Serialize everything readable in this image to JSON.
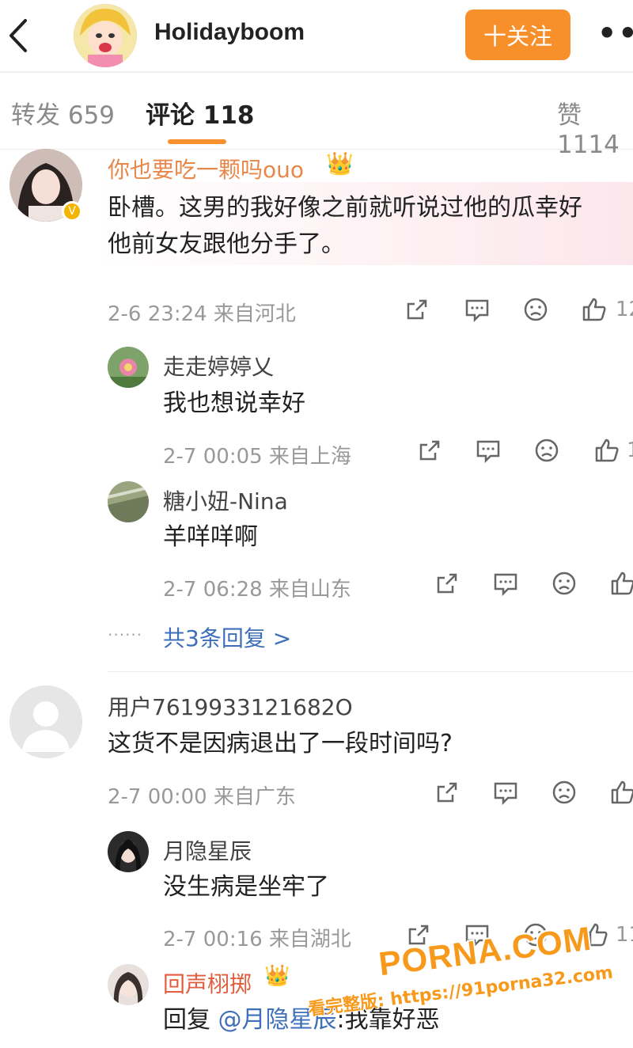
{
  "header": {
    "back_icon": "chevron-left-icon",
    "username": "Holidayboom",
    "follow_label": "十关注",
    "more_label": "•••",
    "accent": "#f7902b"
  },
  "tabs": {
    "repost": "转发 659",
    "comment": "评论 118",
    "like": "赞 1114"
  },
  "comments": [
    {
      "name": "你也要吃一颗吗ouo",
      "name_color": "#e8874a",
      "badge": "👑",
      "text_line1": "卧槽。这男的我好像之前就听说过他的瓜幸好",
      "text_line2": "他前女友跟他分手了。",
      "meta": "2-6 23:24  来自河北",
      "like_count": "12",
      "replies": [
        {
          "name": "走走婷婷乂",
          "text": "我也想说幸好",
          "meta": "2-7 00:05  来自上海",
          "like_count": "1"
        },
        {
          "name": "糖小妞-Nina",
          "text": "羊咩咩啊",
          "meta": "2-7 06:28  来自山东",
          "like_count": ""
        }
      ],
      "more_replies": "共3条回复 >",
      "more_dots": "······"
    },
    {
      "name": "用户7619933121682O",
      "text": "这货不是因病退出了一段时间吗?",
      "meta": "2-7 00:00  来自广东",
      "like_count": "",
      "replies": [
        {
          "name": "月隐星辰",
          "text": "没生病是坐牢了",
          "meta": "2-7 00:16  来自湖北",
          "like_count": "11"
        },
        {
          "name": "回声栩掷",
          "name_color": "#e25d3d",
          "badge": "👑",
          "text_prefix": "回复 ",
          "mention": "@月隐星辰",
          "text_suffix": ":我靠好恶",
          "meta": "",
          "like_count": ""
        }
      ]
    }
  ],
  "watermark": {
    "brand": "PORNA.COM",
    "line": "看完整版: https://91porna32.com"
  }
}
